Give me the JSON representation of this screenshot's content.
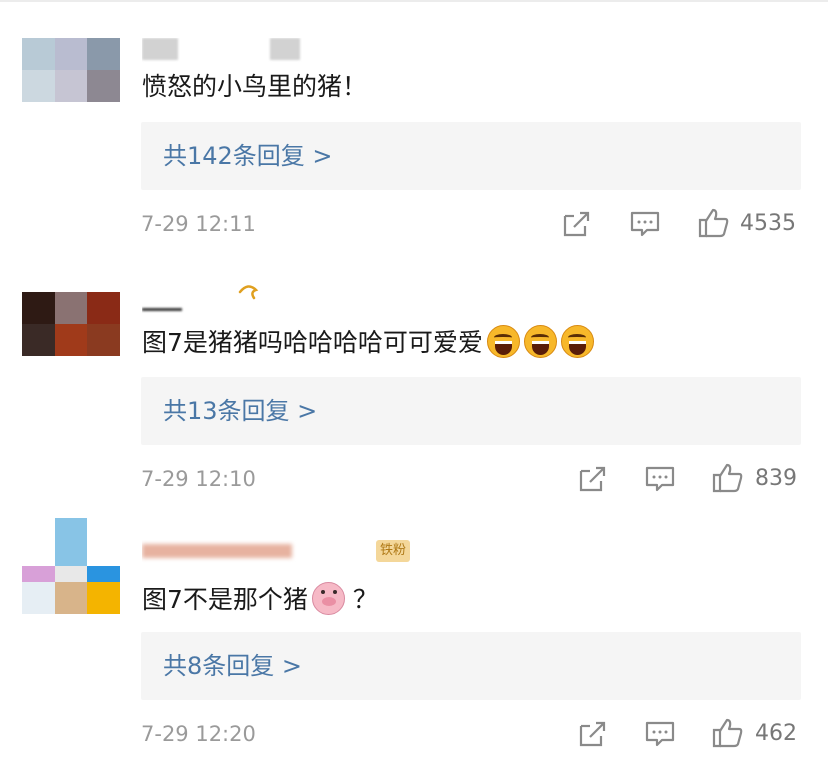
{
  "comments": [
    {
      "text": "愤怒的小鸟里的猪！",
      "reply_label": "共142条回复 >",
      "timestamp": "7-29 12:11",
      "likes": "4535",
      "avatar_colors": [
        "#b8cad6",
        "#b9bcd0",
        "#8a99aa",
        "#ccd8e0",
        "#c6c5d3",
        "#8d8892"
      ]
    },
    {
      "text": "图7是猪猪吗哈哈哈哈可可爱爱",
      "emoji_icons": [
        "grinning-face-icon",
        "grinning-face-icon",
        "grinning-face-icon"
      ],
      "reply_label": "共13条回复 >",
      "timestamp": "7-29 12:10",
      "likes": "839",
      "avatar_colors": [
        "#2e1a14",
        "#8a7272",
        "#8a2a16",
        "#3a2a26",
        "#a03a1a",
        "#8a3a20"
      ]
    },
    {
      "text": "图7不是那个猪",
      "text_suffix": "？",
      "emoji_icons": [
        "pig-face-icon"
      ],
      "user_badge": "铁粉",
      "reply_label": "共8条回复 >",
      "timestamp": "7-29 12:20",
      "likes": "462",
      "avatar_colors": [
        "#ffffff",
        "#88c4e6",
        "#ffffff",
        "#d8a0d8",
        "#e8e8e8",
        "#2a94e0",
        "#e6eef4",
        "#d8b48a",
        "#f4b400"
      ]
    }
  ],
  "icons": {
    "share": "share-icon",
    "reply": "comment-icon",
    "like": "thumbs-up-icon"
  },
  "colors": {
    "link": "#4a77a6",
    "meta": "#9a9a9a",
    "reply_bg": "#f5f5f5"
  }
}
